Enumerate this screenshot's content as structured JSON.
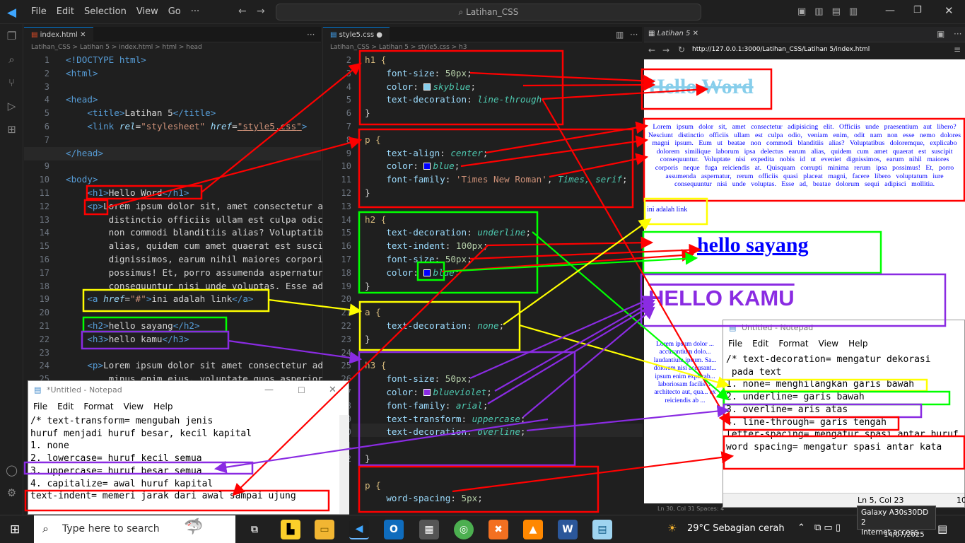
{
  "titlebar": {
    "menu": [
      "File",
      "Edit",
      "Selection",
      "View",
      "Go",
      "···"
    ],
    "search": "Latihan_CSS"
  },
  "left_editor": {
    "tab": "index.html",
    "breadcrumb": "Latihan_CSS > Latihan 5 > index.html > html > head",
    "lines": [
      "1",
      "2",
      "3",
      "4",
      "5",
      "6",
      "7",
      "8",
      "9",
      "10",
      "11",
      "12",
      "13",
      "14",
      "15",
      "16",
      "17",
      "18",
      "19",
      "20",
      "21",
      "22",
      "23",
      "24",
      "25"
    ],
    "code": {
      "l1": "<!DOCTYPE html>",
      "l2": "<html>",
      "l4": "<head>",
      "l5_title": "Latihan 5",
      "l6_rel": "stylesheet",
      "l6_href": "style5.css",
      "l8": "</head>",
      "l10": "<body>",
      "l11": "Hello Word",
      "l12": "Lorem ipsum dolor sit, amet consectetur a",
      "l13": "distinctio officiis ullam est culpa odic",
      "l14": "non commodi blanditiis alias? Voluptatib",
      "l15": "alias, quidem cum amet quaerat est susci",
      "l16": "dignissimos, earum nihil maiores corpori",
      "l17": "possimus! Et, porro assumenda aspernatur",
      "l18": "consequuntur nisi unde voluptas. Esse ad",
      "l19_href": "#",
      "l19_text": "ini adalah link",
      "l21": "hello sayang",
      "l22": "hello kamu",
      "l24": "Lorem ipsum dolor sit amet consectetur ad",
      "l25": "minus enim eius, voluptate quos asperior"
    }
  },
  "right_editor": {
    "tab": "style5.css",
    "breadcrumb": "Latihan_CSS > Latihan 5 > style5.css > h3",
    "lines": [
      "2",
      "3",
      "4",
      "5",
      "6",
      "7",
      "8",
      "9",
      "10",
      "11",
      "12",
      "13",
      "14",
      "15",
      "16",
      "17",
      "18",
      "19",
      "20",
      "21",
      "22",
      "23",
      "24",
      "25",
      "26",
      "27",
      "28",
      "29",
      "30",
      "31",
      "32"
    ],
    "h1": {
      "sel": "h1 {",
      "fs": "50px",
      "color": "skyblue",
      "td": "line-through"
    },
    "p": {
      "sel": "p {",
      "ta": "center",
      "color": "blue",
      "ff": "'Times New Roman'",
      "ff2": "Times, serif"
    },
    "h2": {
      "sel": "h2 {",
      "td": "underline",
      "ti": "100px",
      "fs": "50px",
      "color": "blue"
    },
    "a": {
      "sel": "a {",
      "td": "none"
    },
    "h3": {
      "sel": "h3 {",
      "fs": "50px",
      "color": "blueviolet",
      "ff": "arial",
      "tt": "uppercase",
      "td": "overline"
    },
    "p2": {
      "sel": "p {",
      "ws": "5px"
    }
  },
  "browser": {
    "tab": "Latihan 5",
    "url": "http://127.0.0.1:3000/Latihan_CSS/Latihan 5/index.html",
    "h1": "Hello Word",
    "para": "Lorem ipsum dolor sit, amet consectetur adipisicing elit. Officiis unde praesentium aut libero? Nesciunt distinctio officiis ullam est culpa odio, veniam enim, odit nam non esse nemo dolores magni ipsum. Eum ut beatae non commodi blanditiis alias? Voluptatibus doloremque, explicabo dolorem similique laborum ipsa delectus earum alias, quidem cum amet quaerat est suscipit consequuntur. Voluptate nisi expedita nobis id ut eveniet dignissimos, earum nihil maiores corporis neque fuga reiciendis at. Quisquam corrupti minima rerum ipsa possimus! Et, porro assumenda aspernatur, rerum officiis quasi placeat magni, facere libero voluptatum iure consequuntur nisi unde voluptas. Esse ad, beatae dolorum sequi adipisci mollitia.",
    "link": "ini adalah link",
    "h2": "hello sayang",
    "h3": "HELLO KAMU",
    "para2": "Lorem ipsum dolor ... accusantium dolo... laudantium ipsum. Sa... dolorem nisi accusant... ipsum enim explicab... laboriosam facilis ... architecto aut, qua... ex reiciendis ab ..."
  },
  "notepad_left": {
    "title": "*Untitled - Notepad",
    "menu": [
      "File",
      "Edit",
      "Format",
      "View",
      "Help"
    ],
    "lines": [
      "/* text-transform= mengubah jenis",
      "huruf menjadi huruf besar, kecil kapital",
      "1. none",
      "2. lowercase= huruf kecil semua",
      "3. uppercase= huruf besar semua",
      "4. capitalize= awal huruf kapital",
      "",
      "text-indent= memeri jarak dari awal sampai ujung"
    ]
  },
  "notepad_right": {
    "title": "Untitled - Notepad",
    "menu": [
      "File",
      "Edit",
      "Format",
      "View",
      "Help"
    ],
    "lines": [
      "/* text-decoration= mengatur dekorasi",
      " pada text",
      "1. none= menghilangkan garis bawah",
      "2. underline= garis bawah",
      "3. overline= aris atas",
      "4. line-through= garis tengah",
      "",
      "letter-spacing= mengatur spasi antar huruf",
      "word spacing= mengatur spasi antar kata"
    ],
    "status": "Ln 5, Col 23",
    "zoom": "100"
  },
  "statusbar": "Ln 30, Col 31   Spaces: 4   UTF-8   CRLF   {} CSS",
  "taskbar": {
    "search": "Type here to search",
    "weather": "29°C  Sebagian cerah",
    "date": "14/07/2025",
    "tooltip1": "Galaxy A30s30DD 2",
    "tooltip2": "Internet access"
  },
  "colors": {
    "accent": "#0078d4",
    "annot_red": "#ff0000",
    "annot_green": "#00ff00",
    "annot_yellow": "#ffff00",
    "annot_purple": "#8a2be2"
  }
}
